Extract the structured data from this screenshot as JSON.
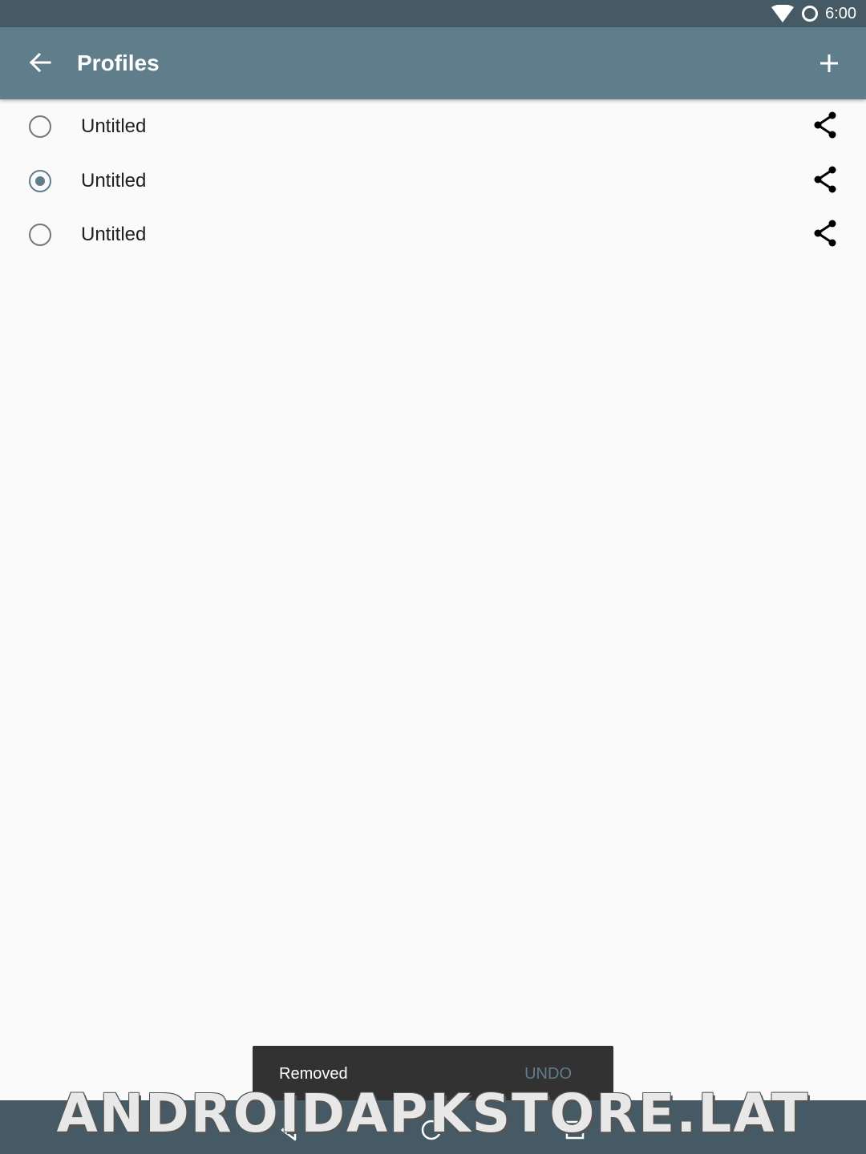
{
  "status_bar": {
    "time": "6:00",
    "icons": [
      "wifi-icon",
      "sync-icon"
    ]
  },
  "app_bar": {
    "title": "Profiles",
    "back_icon": "arrow-back-icon",
    "add_icon": "add-icon",
    "color": "#607D8B"
  },
  "profiles": [
    {
      "label": "Untitled",
      "selected": false
    },
    {
      "label": "Untitled",
      "selected": true
    },
    {
      "label": "Untitled",
      "selected": false
    }
  ],
  "snackbar": {
    "message": "Removed",
    "action": "UNDO"
  },
  "nav_bar": {
    "buttons": [
      "back-icon",
      "home-icon",
      "recents-icon"
    ]
  },
  "watermark": "ANDROIDAPKSTORE.LAT"
}
